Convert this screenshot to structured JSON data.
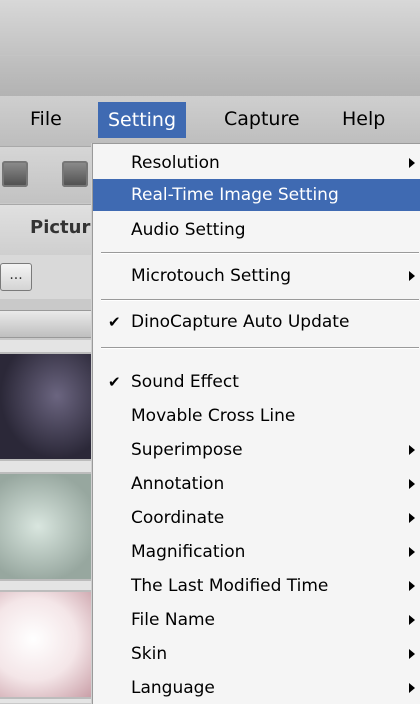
{
  "menubar": {
    "items": [
      "File",
      "Setting",
      "Capture",
      "Help"
    ]
  },
  "left_panel": {
    "title": "Pictur",
    "browse_label": "..."
  },
  "setting_menu": {
    "items": [
      {
        "label": "Resolution",
        "submenu": true,
        "checked": false
      },
      {
        "label": "Real-Time Image Setting",
        "submenu": false,
        "checked": false,
        "highlighted": true
      },
      {
        "label": "Audio Setting",
        "submenu": false,
        "checked": false
      },
      {
        "label": "Microtouch Setting",
        "submenu": true,
        "checked": false
      },
      {
        "label": "DinoCapture Auto Update",
        "submenu": false,
        "checked": true
      },
      {
        "label": "Sound Effect",
        "submenu": false,
        "checked": true
      },
      {
        "label": "Movable Cross Line",
        "submenu": false,
        "checked": false
      },
      {
        "label": "Superimpose",
        "submenu": true,
        "checked": false
      },
      {
        "label": "Annotation",
        "submenu": true,
        "checked": false
      },
      {
        "label": "Coordinate",
        "submenu": true,
        "checked": false
      },
      {
        "label": "Magnification",
        "submenu": true,
        "checked": false
      },
      {
        "label": "The Last Modified Time",
        "submenu": true,
        "checked": false
      },
      {
        "label": "File Name",
        "submenu": true,
        "checked": false
      },
      {
        "label": "Skin",
        "submenu": true,
        "checked": false
      },
      {
        "label": "Language",
        "submenu": true,
        "checked": false
      }
    ],
    "check_glyph": "✔"
  },
  "colors": {
    "highlight": "#3f6ab2"
  }
}
